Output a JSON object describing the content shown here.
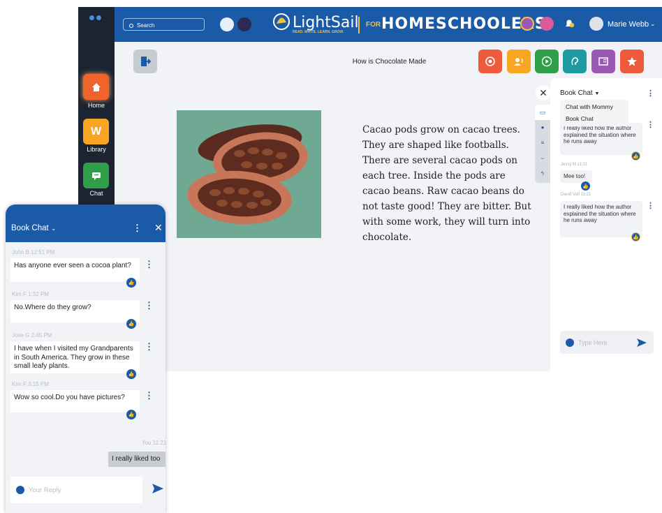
{
  "sidebar": {
    "items": [
      {
        "label": "Home",
        "icon": "home-icon",
        "color": "#f0632a"
      },
      {
        "label": "Library",
        "icon": "library-icon",
        "glyph": "W",
        "color": "#f6a623"
      },
      {
        "label": "Chat",
        "icon": "chat-icon",
        "color": "#2e9f48"
      }
    ]
  },
  "header": {
    "search_label": "Search",
    "logo_text": "LightSail",
    "logo_tagline": "READ. WRITE. LEARN. GROW.",
    "for_label": "FOR",
    "product_label": "HOMESCHOOLERS",
    "user_name": "Marie Webb",
    "notification_count": "1",
    "brand_color": "#1b5aa6",
    "accent_color": "#f3c237"
  },
  "reader": {
    "book_title": "How is Chocolate Made",
    "passage": "Cacao pods grow on cacao trees. They are shaped like footballs. There are several cacao pods on each tree. Inside the pods are cacao beans. Raw cacao beans do not taste good! They are bitter. But with some work, they will turn into chocolate.",
    "toolbar": [
      {
        "name": "target-icon",
        "color": "#ef5a3c"
      },
      {
        "name": "read-aloud-icon",
        "color": "#f6a623"
      },
      {
        "name": "play-icon",
        "color": "#2e9f48"
      },
      {
        "name": "listen-icon",
        "color": "#1e9aa3"
      },
      {
        "name": "book-icon",
        "color": "#9b59b6"
      },
      {
        "name": "star-icon",
        "color": "#ef5a3c"
      }
    ]
  },
  "right_panel": {
    "chat_selector": "Book Chat",
    "menu_options": [
      "Chat with Mommy",
      "Book Chat"
    ],
    "messages": [
      {
        "author": "",
        "time": "",
        "text": "I really liked how the author explained the situation where he runs away"
      },
      {
        "author": "Jessy M",
        "time": "11:21",
        "text": "Mee too!"
      },
      {
        "author": "David Volf",
        "time": "11:21",
        "text": "I really liked how the author explained the situation where he runs away"
      }
    ],
    "input_placeholder": "Type Here"
  },
  "chat_window": {
    "title": "Book Chat",
    "messages": [
      {
        "meta": "John B 12:51 PM",
        "text": "Has anyone ever seen a cocoa plant?"
      },
      {
        "meta": "Kim F 1:32 PM",
        "text": "No.Where do they grow?"
      },
      {
        "meta": "Jose G 2:45 PM",
        "text": "I have when I visited my Grandparents in South America. They grow in these small leafy plants."
      },
      {
        "meta": "Kim F  3:15 PM",
        "text": "Wow so cool.Do you have pictures?"
      }
    ],
    "own_meta": "You 11:21",
    "own_message": "I really liked too",
    "reply_placeholder": "Your Reply"
  }
}
